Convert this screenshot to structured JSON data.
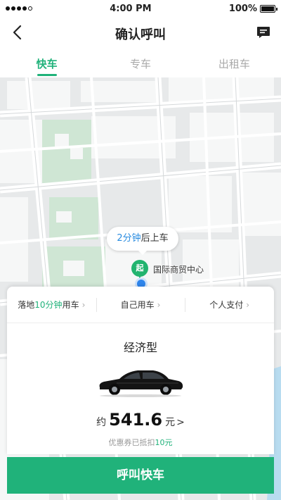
{
  "status_bar": {
    "time": "4:00 PM",
    "battery": "100%",
    "battery_level": 1.0
  },
  "header": {
    "title": "确认呼叫"
  },
  "tabs": [
    {
      "label": "快车",
      "active": true
    },
    {
      "label": "专车",
      "active": false
    },
    {
      "label": "出租车",
      "active": false
    }
  ],
  "map": {
    "pickup_time": "2分钟",
    "pickup_suffix": "后上车",
    "start_pin_label": "起",
    "place_name": "国际商贸中心"
  },
  "options": {
    "landing_prefix": "落地",
    "landing_time": "10分钟",
    "landing_suffix": "用车",
    "self_use": "自己用车",
    "payment": "个人支付",
    "chevron": "›"
  },
  "ride": {
    "type": "经济型",
    "price_prefix": "约",
    "price": "541.6",
    "price_unit": "元",
    "price_chevron": ">",
    "coupon_text": "优惠券已抵扣",
    "coupon_amount": "10元"
  },
  "call_button": "呼叫快车",
  "colors": {
    "accent": "#20b27a",
    "link_blue": "#2a8ce0",
    "location_blue": "#2f86ec"
  },
  "icons": {
    "back": "back-icon",
    "message": "message-icon",
    "shield": "shield-icon",
    "locate": "locate-icon"
  }
}
